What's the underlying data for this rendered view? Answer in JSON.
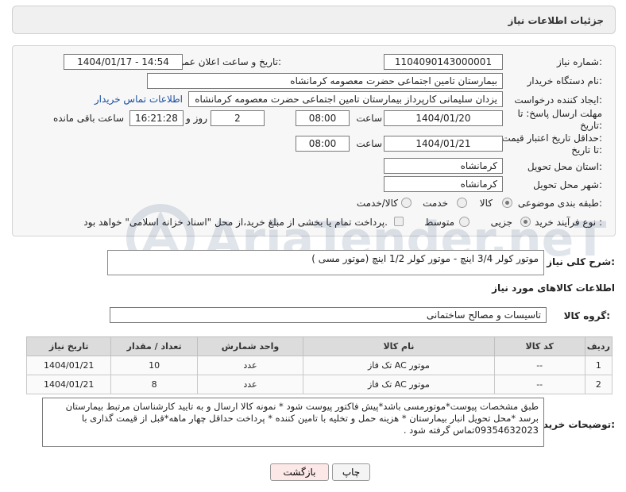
{
  "header": {
    "title": "جزئیات اطلاعات نیاز"
  },
  "form": {
    "need_number": {
      "label": "شماره نیاز:",
      "value": "1104090143000001"
    },
    "announce_datetime": {
      "label": "تاریخ و ساعت اعلان عمومی:",
      "value": "1404/01/17 - 14:54"
    },
    "buyer_org": {
      "label": "نام دستگاه خریدار:",
      "value": "بیمارستان تامین اجتماعی حضرت معصومه کرمانشاه"
    },
    "requester": {
      "label": "ایجاد کننده درخواست:",
      "value": "یزدان  سلیمانی کارپرداز بیمارستان تامین اجتماعی حضرت معصومه کرمانشاه",
      "contact_link": "اطلاعات تماس خریدار"
    },
    "reply_deadline": {
      "label_line1": "مهلت ارسال پاسخ: تا",
      "label_line2": "تاریخ:",
      "date": "1404/01/20",
      "time_label": "ساعت",
      "time": "08:00",
      "days": "2",
      "days_label": "روز و",
      "remaining_time": "16:21:28",
      "remaining_label": "ساعت باقی مانده"
    },
    "price_validity": {
      "label_line1": "حداقل تاریخ اعتبار قیمت:",
      "label_line2": "تا تاریخ:",
      "date": "1404/01/21",
      "time_label": "ساعت",
      "time": "08:00"
    },
    "delivery_province": {
      "label": "استان محل تحویل:",
      "value": "کرمانشاه"
    },
    "delivery_city": {
      "label": "شهر محل تحویل:",
      "value": "کرمانشاه"
    },
    "category": {
      "label": "طبقه بندی موضوعی:",
      "options": [
        "کالا",
        "خدمت",
        "کالا/خدمت"
      ],
      "selected": "کالا"
    },
    "process_type": {
      "label": "نوع فرآیند خرید :",
      "options": [
        "جزیی",
        "متوسط"
      ],
      "selected": "جزیی",
      "payment_note": "پرداخت تمام یا بخشی از مبلغ خرید،از محل \"اسناد خزانه اسلامی\" خواهد بود."
    }
  },
  "summary": {
    "label": "شرح کلی نیاز:",
    "value": "موتور کولر 3/4 اینچ  - موتور کولر 1/2 اینچ (موتور مسی )"
  },
  "goods_section": {
    "title": "اطلاعات کالاهای مورد نیاز",
    "group_label": "گروه کالا:",
    "group_value": "تاسیسات و مصالح ساختمانی"
  },
  "table": {
    "headers": [
      "ردیف",
      "کد کالا",
      "نام کالا",
      "واحد شمارش",
      "تعداد / مقدار",
      "تاریخ نیاز"
    ],
    "rows": [
      [
        "1",
        "--",
        "موتور AC تک فاز",
        "عدد",
        "10",
        "1404/01/21"
      ],
      [
        "2",
        "--",
        "موتور AC تک فاز",
        "عدد",
        "8",
        "1404/01/21"
      ]
    ]
  },
  "buyer_notes": {
    "label": "توضیحات خریدار:",
    "value": "طبق مشخصات پیوست*موتورمسی باشد*پیش فاکتور پیوست شود * نمونه کالا ارسال و به تایید کارشناسان مرتبط بیمارستان برسد *محل تحویل انبار بیمارستان * هزینه حمل و تخلیه با تامین کننده * پرداخت حداقل چهار ماهه*قبل از قیمت گذاری با 09354632023تماس گرفته شود ."
  },
  "buttons": {
    "print": "چاپ",
    "back": "بازگشت"
  },
  "watermark": {
    "text": "AriaTender.neT"
  },
  "colors": {
    "header_bg": "#f0f0f0",
    "panel_bg": "#f7f7f7",
    "table_header_bg": "#dcdcdc",
    "back_button_bg": "#fde8e8",
    "link": "#1a4fa0"
  }
}
